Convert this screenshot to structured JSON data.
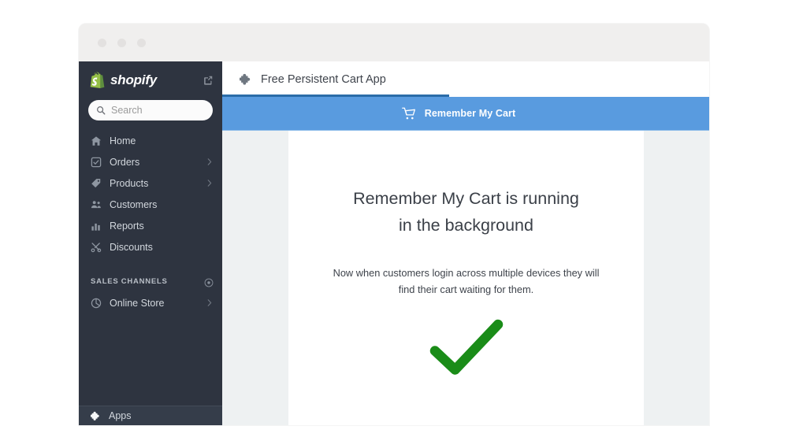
{
  "window": {
    "traffic_lights": [
      "close",
      "minimize",
      "maximize"
    ]
  },
  "sidebar": {
    "brand": {
      "wordmark": "shopify",
      "logo_icon": "shopify-bag-icon",
      "external_link_icon": "external-link-icon",
      "logo_color": "#95bf47"
    },
    "search": {
      "placeholder": "Search",
      "value": "",
      "icon": "search-icon"
    },
    "items": [
      {
        "label": "Home",
        "icon": "home-icon",
        "chevron": false
      },
      {
        "label": "Orders",
        "icon": "orders-icon",
        "chevron": true
      },
      {
        "label": "Products",
        "icon": "products-tag-icon",
        "chevron": true
      },
      {
        "label": "Customers",
        "icon": "customers-icon",
        "chevron": false
      },
      {
        "label": "Reports",
        "icon": "reports-bar-chart-icon",
        "chevron": false
      },
      {
        "label": "Discounts",
        "icon": "discounts-scissors-icon",
        "chevron": false
      }
    ],
    "section": {
      "title": "SALES CHANNELS",
      "add_icon": "plus-circle-icon"
    },
    "channels": [
      {
        "label": "Online Store",
        "icon": "globe-icon",
        "chevron": true
      }
    ],
    "footer": {
      "label": "Apps",
      "icon": "puzzle-piece-icon"
    },
    "background_color": "#2e3440"
  },
  "main": {
    "tab": {
      "label": "Free Persistent Cart App",
      "icon": "puzzle-piece-icon",
      "active": true,
      "underline_color": "#2b6ca8"
    },
    "appbar": {
      "label": "Remember My Cart",
      "icon": "shopping-cart-icon",
      "background_color": "#599bdf"
    },
    "content": {
      "headline_line1": "Remember My Cart is running",
      "headline_line2": "in the background",
      "subtext_line1": "Now when customers login across multiple devices they will",
      "subtext_line2": "find their cart waiting for them.",
      "status_icon": "green-checkmark-icon",
      "status_color": "#1a8c18"
    }
  }
}
